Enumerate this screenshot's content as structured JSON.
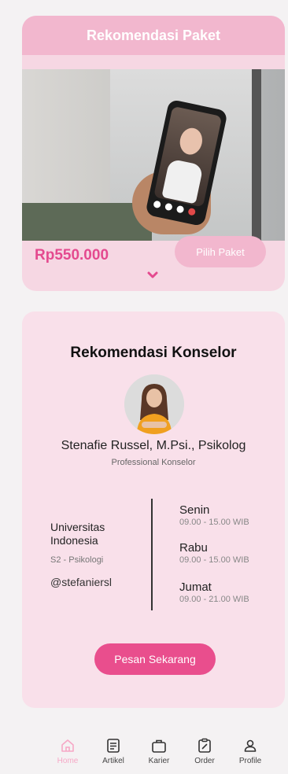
{
  "package": {
    "header": "Rekomendasi Paket",
    "price": "Rp550.000",
    "button": "Pilih Paket"
  },
  "counselor": {
    "title": "Rekomendasi Konselor",
    "name": "Stenafie Russel, M.Psi., Psikolog",
    "role": "Professional Konselor",
    "university": "Universitas Indonesia",
    "degree": "S2 - Psikologi",
    "handle": "@stefaniersl",
    "schedule": [
      {
        "day": "Senin",
        "time": "09.00 - 15.00 WIB"
      },
      {
        "day": "Rabu",
        "time": "09.00 - 15.00 WIB"
      },
      {
        "day": "Jumat",
        "time": "09.00 - 21.00 WIB"
      }
    ],
    "button": "Pesan Sekarang"
  },
  "nav": {
    "items": [
      {
        "label": "Home",
        "icon": "home-icon",
        "active": true
      },
      {
        "label": "Artikel",
        "icon": "article-icon"
      },
      {
        "label": "Karier",
        "icon": "briefcase-icon"
      },
      {
        "label": "Order",
        "icon": "order-icon"
      },
      {
        "label": "Profile",
        "icon": "profile-icon"
      }
    ]
  },
  "colors": {
    "accent": "#e94e8d",
    "header_pink": "#f2b7ce",
    "card_pink": "#f6d7e3",
    "nav_active": "#f6a8c6"
  }
}
